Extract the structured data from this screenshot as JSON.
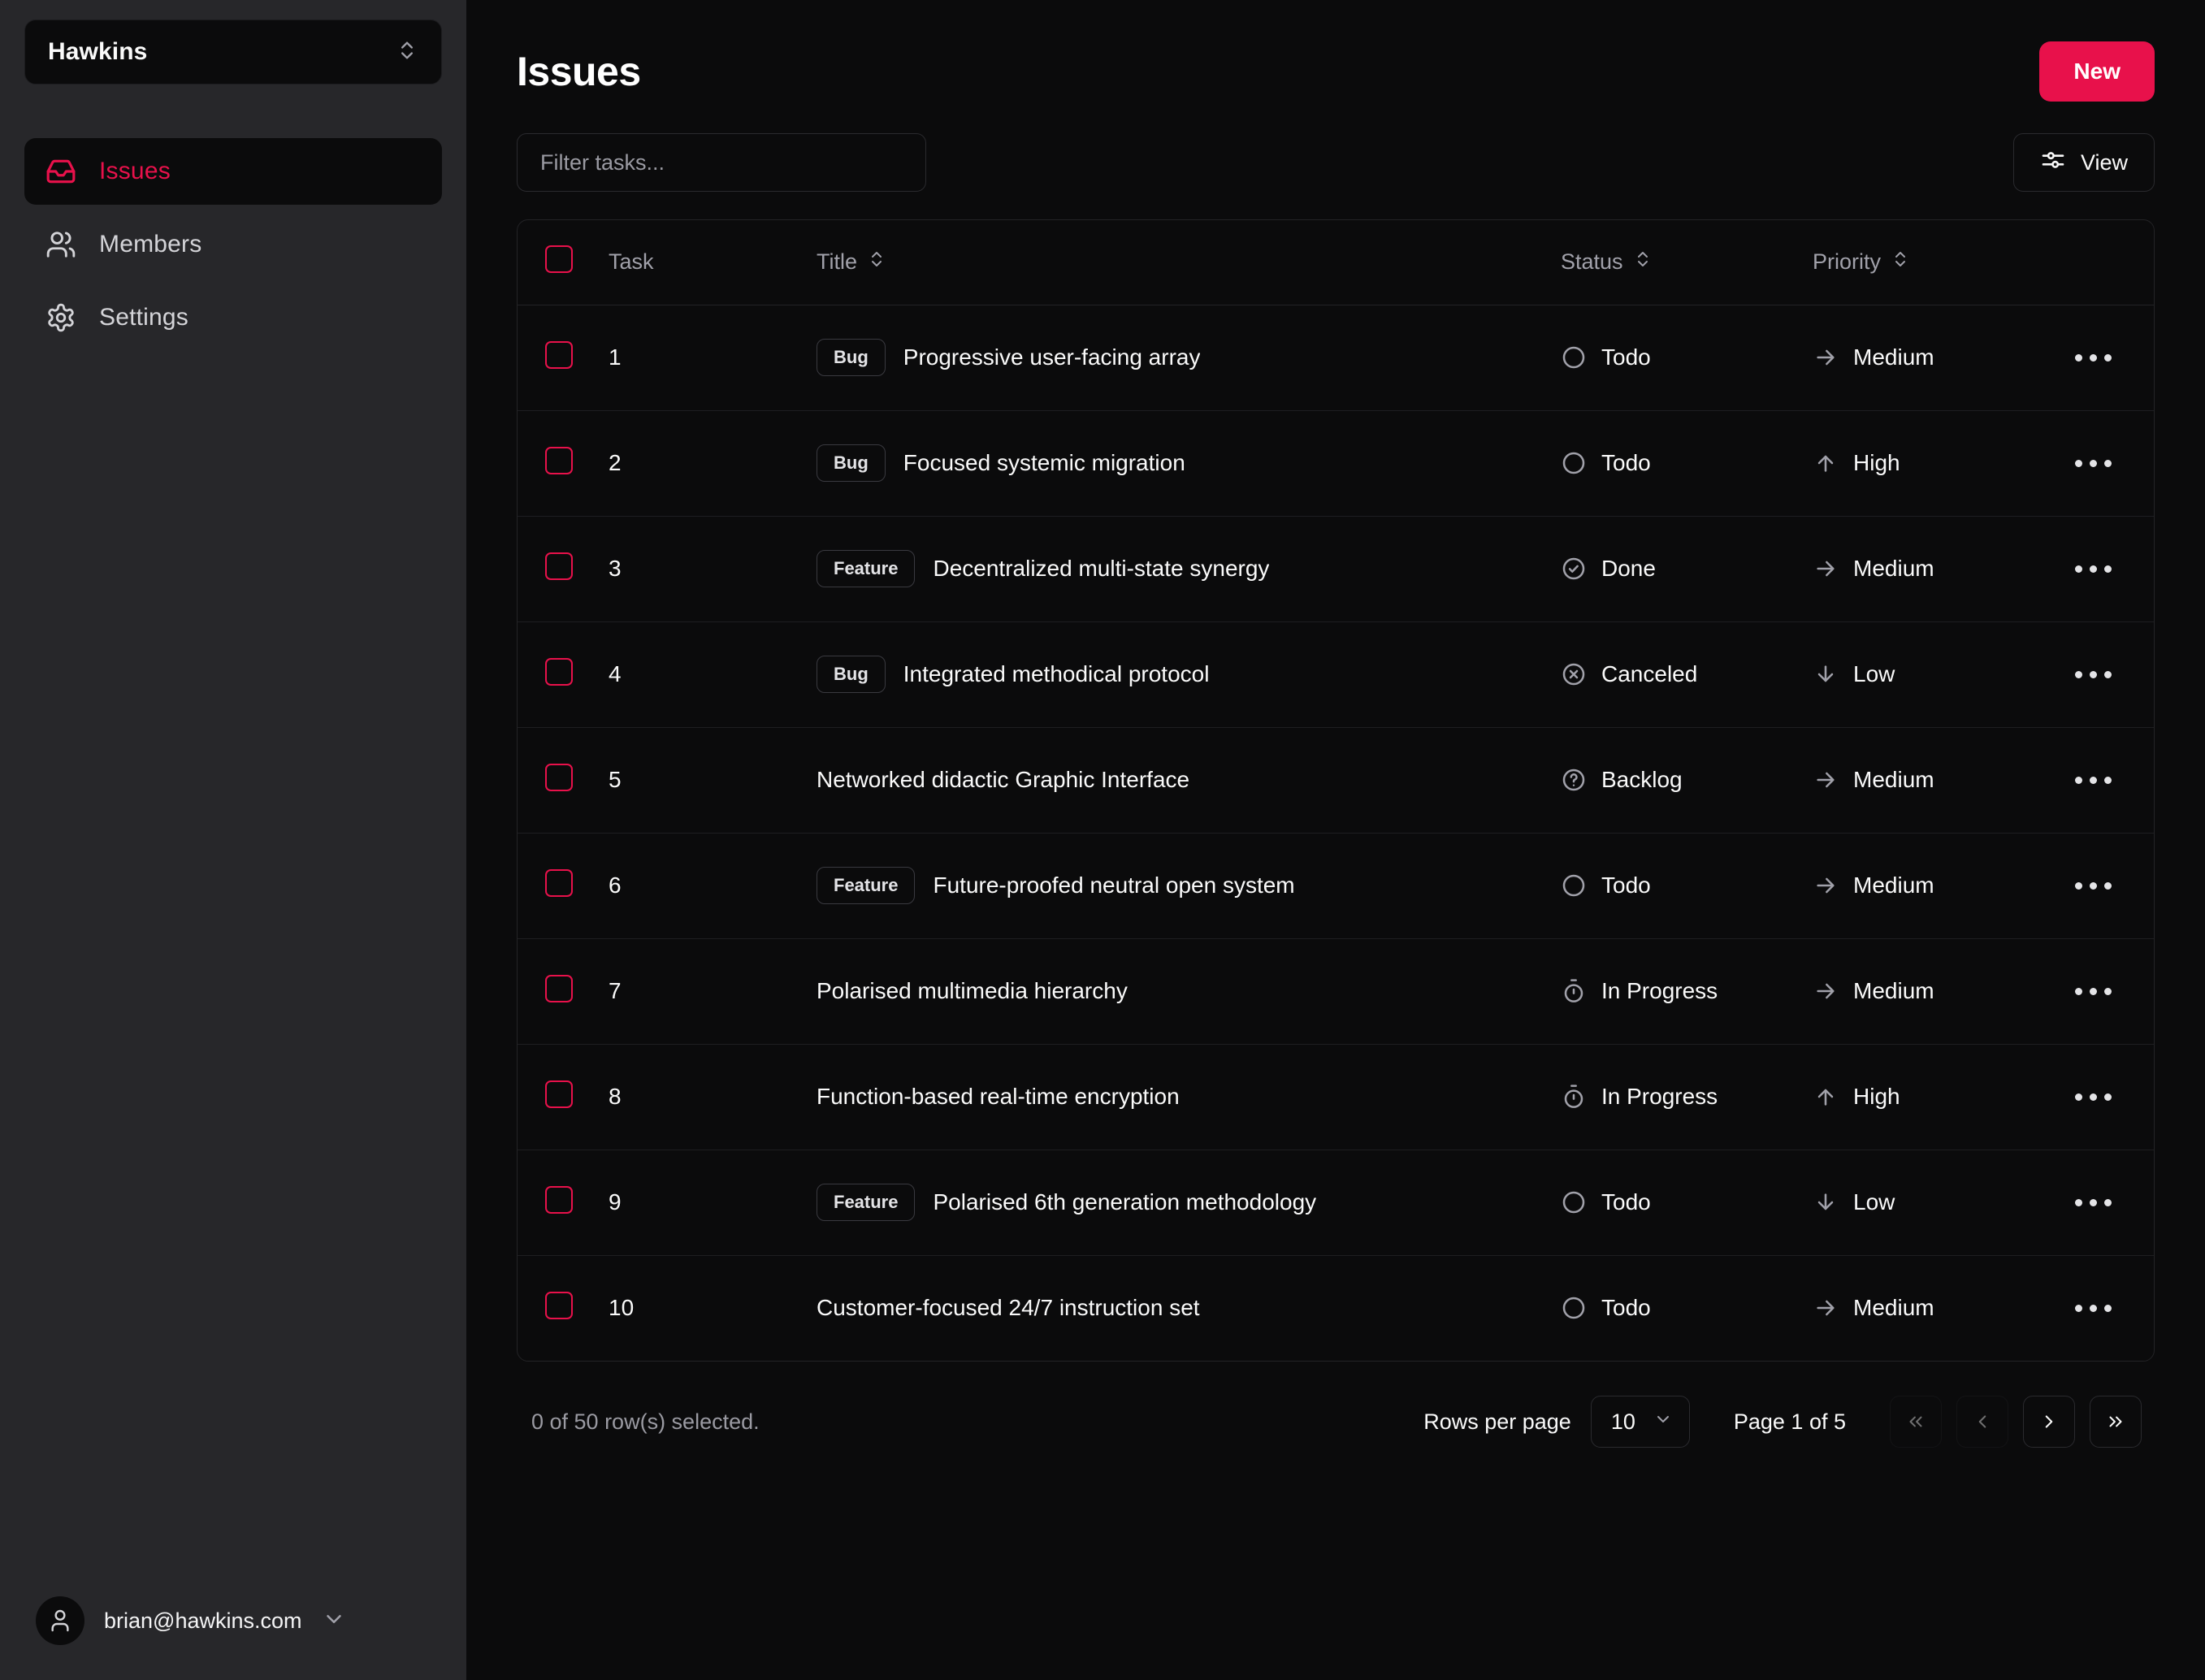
{
  "sidebar": {
    "team_switcher": {
      "name": "Hawkins",
      "icon": "chevrons-up-down-icon"
    },
    "items": [
      {
        "label": "Issues",
        "icon": "inbox-icon",
        "active": true
      },
      {
        "label": "Members",
        "icon": "users-icon",
        "active": false
      },
      {
        "label": "Settings",
        "icon": "gear-icon",
        "active": false
      }
    ],
    "user": {
      "email": "brian@hawkins.com",
      "icon": "user-icon",
      "chevron": "chevron-down-icon"
    }
  },
  "header": {
    "title": "Issues",
    "new_button": "New"
  },
  "toolbar": {
    "filter_placeholder": "Filter tasks...",
    "filter_value": "",
    "view_button": "View",
    "view_icon": "sliders-icon"
  },
  "table": {
    "columns": [
      {
        "key": "select",
        "label": "",
        "sortable": false
      },
      {
        "key": "task",
        "label": "Task",
        "sortable": false
      },
      {
        "key": "title",
        "label": "Title",
        "sortable": true
      },
      {
        "key": "status",
        "label": "Status",
        "sortable": true
      },
      {
        "key": "priority",
        "label": "Priority",
        "sortable": true
      },
      {
        "key": "actions",
        "label": "",
        "sortable": false
      }
    ],
    "rows": [
      {
        "task": "1",
        "badge": "Bug",
        "title": "Progressive user-facing array",
        "status": "Todo",
        "status_icon": "circle-icon",
        "priority": "Medium",
        "priority_icon": "arrow-right-icon"
      },
      {
        "task": "2",
        "badge": "Bug",
        "title": "Focused systemic migration",
        "status": "Todo",
        "status_icon": "circle-icon",
        "priority": "High",
        "priority_icon": "arrow-up-icon"
      },
      {
        "task": "3",
        "badge": "Feature",
        "title": "Decentralized multi-state synergy",
        "status": "Done",
        "status_icon": "check-circle-icon",
        "priority": "Medium",
        "priority_icon": "arrow-right-icon"
      },
      {
        "task": "4",
        "badge": "Bug",
        "title": "Integrated methodical protocol",
        "status": "Canceled",
        "status_icon": "x-circle-icon",
        "priority": "Low",
        "priority_icon": "arrow-down-icon"
      },
      {
        "task": "5",
        "badge": "",
        "title": "Networked didactic Graphic Interface",
        "status": "Backlog",
        "status_icon": "question-circle-icon",
        "priority": "Medium",
        "priority_icon": "arrow-right-icon"
      },
      {
        "task": "6",
        "badge": "Feature",
        "title": "Future-proofed neutral open system",
        "status": "Todo",
        "status_icon": "circle-icon",
        "priority": "Medium",
        "priority_icon": "arrow-right-icon"
      },
      {
        "task": "7",
        "badge": "",
        "title": "Polarised multimedia hierarchy",
        "status": "In Progress",
        "status_icon": "timer-icon",
        "priority": "Medium",
        "priority_icon": "arrow-right-icon"
      },
      {
        "task": "8",
        "badge": "",
        "title": "Function-based real-time encryption",
        "status": "In Progress",
        "status_icon": "timer-icon",
        "priority": "High",
        "priority_icon": "arrow-up-icon"
      },
      {
        "task": "9",
        "badge": "Feature",
        "title": "Polarised 6th generation methodology",
        "status": "Todo",
        "status_icon": "circle-icon",
        "priority": "Low",
        "priority_icon": "arrow-down-icon"
      },
      {
        "task": "10",
        "badge": "",
        "title": "Customer-focused 24/7 instruction set",
        "status": "Todo",
        "status_icon": "circle-icon",
        "priority": "Medium",
        "priority_icon": "arrow-right-icon"
      }
    ]
  },
  "pagination": {
    "selection_text": "0 of 50 row(s) selected.",
    "rows_per_page_label": "Rows per page",
    "rows_per_page_value": "10",
    "page_label": "Page 1 of 5",
    "buttons": [
      {
        "name": "first-page-button",
        "icon": "chevrons-left-icon",
        "disabled": true
      },
      {
        "name": "prev-page-button",
        "icon": "chevron-left-icon",
        "disabled": true
      },
      {
        "name": "next-page-button",
        "icon": "chevron-right-icon",
        "disabled": false
      },
      {
        "name": "last-page-button",
        "icon": "chevrons-right-icon",
        "disabled": false
      }
    ]
  },
  "colors": {
    "accent": "#e8114b",
    "sidebar_bg": "#27272a",
    "main_bg": "#0b0b0c",
    "border": "#232326",
    "muted_text": "#9a9aa2"
  }
}
